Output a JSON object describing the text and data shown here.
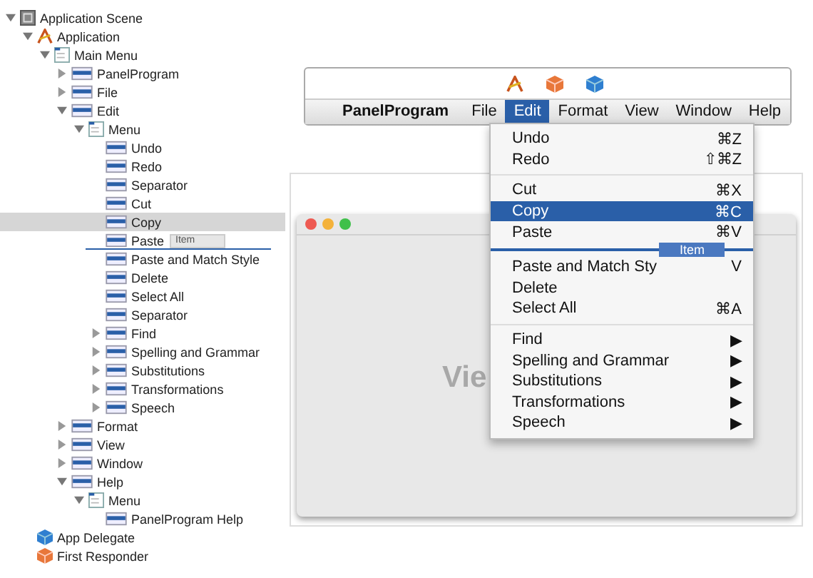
{
  "tree": [
    {
      "label": "Application Scene",
      "kind": "scene",
      "expanded": true,
      "selected": false,
      "children": [
        {
          "label": "Application",
          "kind": "app",
          "expanded": true,
          "selected": false,
          "children": [
            {
              "label": "Main Menu",
              "kind": "menu",
              "expanded": true,
              "selected": false,
              "children": [
                {
                  "label": "PanelProgram",
                  "kind": "item",
                  "expanded": false,
                  "selected": false
                },
                {
                  "label": "File",
                  "kind": "item",
                  "expanded": false,
                  "selected": false
                },
                {
                  "label": "Edit",
                  "kind": "item",
                  "expanded": true,
                  "selected": false,
                  "children": [
                    {
                      "label": "Menu",
                      "kind": "menu",
                      "expanded": true,
                      "selected": false,
                      "children": [
                        {
                          "label": "Undo",
                          "kind": "item",
                          "selected": false
                        },
                        {
                          "label": "Redo",
                          "kind": "item",
                          "selected": false
                        },
                        {
                          "label": "Separator",
                          "kind": "item",
                          "selected": false
                        },
                        {
                          "label": "Cut",
                          "kind": "item",
                          "selected": false
                        },
                        {
                          "label": "Copy",
                          "kind": "item",
                          "selected": true
                        },
                        {
                          "label": "Paste",
                          "kind": "item",
                          "selected": false,
                          "drag_label": "Item"
                        },
                        {
                          "label": "Paste and Match Style",
                          "kind": "item",
                          "selected": false
                        },
                        {
                          "label": "Delete",
                          "kind": "item",
                          "selected": false
                        },
                        {
                          "label": "Select All",
                          "kind": "item",
                          "selected": false
                        },
                        {
                          "label": "Separator",
                          "kind": "item",
                          "selected": false
                        },
                        {
                          "label": "Find",
                          "kind": "item",
                          "expanded": false,
                          "selected": false
                        },
                        {
                          "label": "Spelling and Grammar",
                          "kind": "item",
                          "expanded": false,
                          "selected": false
                        },
                        {
                          "label": "Substitutions",
                          "kind": "item",
                          "expanded": false,
                          "selected": false
                        },
                        {
                          "label": "Transformations",
                          "kind": "item",
                          "expanded": false,
                          "selected": false
                        },
                        {
                          "label": "Speech",
                          "kind": "item",
                          "expanded": false,
                          "selected": false
                        }
                      ]
                    }
                  ]
                },
                {
                  "label": "Format",
                  "kind": "item",
                  "expanded": false,
                  "selected": false
                },
                {
                  "label": "View",
                  "kind": "item",
                  "expanded": false,
                  "selected": false
                },
                {
                  "label": "Window",
                  "kind": "item",
                  "expanded": false,
                  "selected": false
                },
                {
                  "label": "Help",
                  "kind": "item",
                  "expanded": true,
                  "selected": false,
                  "children": [
                    {
                      "label": "Menu",
                      "kind": "menu",
                      "expanded": true,
                      "selected": false,
                      "children": [
                        {
                          "label": "PanelProgram Help",
                          "kind": "item",
                          "selected": false
                        }
                      ]
                    }
                  ]
                }
              ]
            }
          ]
        },
        {
          "label": "App Delegate",
          "kind": "delegate",
          "selected": false
        },
        {
          "label": "First Responder",
          "kind": "responder",
          "selected": false
        }
      ]
    }
  ],
  "menubar": [
    {
      "label": "PanelProgram",
      "kind": "app",
      "selected": false
    },
    {
      "label": "File",
      "kind": "menu",
      "selected": false
    },
    {
      "label": "Edit",
      "kind": "menu",
      "selected": true
    },
    {
      "label": "Format",
      "kind": "menu",
      "selected": false
    },
    {
      "label": "View",
      "kind": "menu",
      "selected": false
    },
    {
      "label": "Window",
      "kind": "menu",
      "selected": false
    },
    {
      "label": "Help",
      "kind": "menu",
      "selected": false
    }
  ],
  "edit_menu": [
    {
      "kind": "item",
      "label": "Undo",
      "shortcut": "⌘Z",
      "selected": false
    },
    {
      "kind": "item",
      "label": "Redo",
      "shortcut": "⇧⌘Z",
      "selected": false
    },
    {
      "kind": "separator"
    },
    {
      "kind": "item",
      "label": "Cut",
      "shortcut": "⌘X",
      "selected": false
    },
    {
      "kind": "item",
      "label": "Copy",
      "shortcut": "⌘C",
      "selected": true
    },
    {
      "kind": "item",
      "label": "Paste",
      "shortcut": "⌘V",
      "selected": false,
      "drag_label": "Item"
    },
    {
      "kind": "item",
      "label": "Paste and Match Sty",
      "shortcut": "V",
      "selected": false
    },
    {
      "kind": "item",
      "label": "Delete",
      "selected": false
    },
    {
      "kind": "item",
      "label": "Select All",
      "shortcut": "⌘A",
      "selected": false
    },
    {
      "kind": "separator"
    },
    {
      "kind": "item",
      "label": "Find",
      "submenu": "▶",
      "selected": false
    },
    {
      "kind": "item",
      "label": "Spelling and Grammar",
      "submenu": "▶",
      "selected": false
    },
    {
      "kind": "item",
      "label": "Substitutions",
      "submenu": "▶",
      "selected": false
    },
    {
      "kind": "item",
      "label": "Transformations",
      "submenu": "▶",
      "selected": false
    },
    {
      "kind": "item",
      "label": "Speech",
      "submenu": "▶",
      "selected": false
    }
  ],
  "window_content": {
    "label": "Vie"
  }
}
